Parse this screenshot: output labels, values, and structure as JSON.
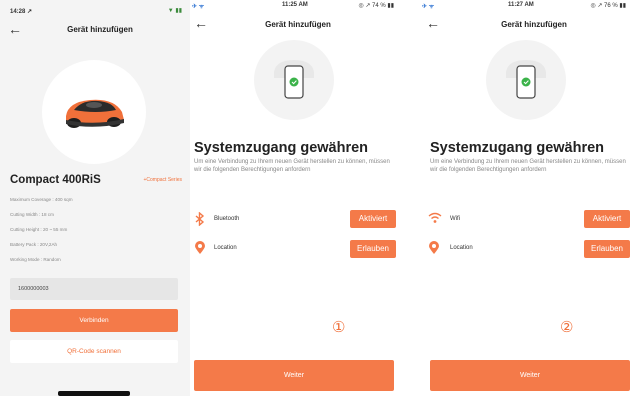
{
  "screen1": {
    "status": {
      "time": "14:28 ↗",
      "right": "▼ ▮▮"
    },
    "title": "Gerät hinzufügen",
    "product_name": "Compact 400RiS",
    "series_link": "+Compact Series",
    "specs": [
      "Maximum Coverage : 400 sqm",
      "Cutting Width : 18 cm",
      "Cutting Height : 20 ~ 55 mm",
      "Battery Pack : 20V,2Ah",
      "Working Mode : Random"
    ],
    "serial_value": "1600000003",
    "connect_button": "Verbinden",
    "qr_button": "QR-Code scannen"
  },
  "screen2": {
    "status": {
      "time": "11:25 AM",
      "left": "✈ ᯤ",
      "right": "◎ ↗ 74 % ▮▮"
    },
    "title": "Gerät hinzufügen",
    "heading": "Systemzugang gewähren",
    "description": "Um eine Verbindung zu Ihrem neuen Gerät herstellen zu können, müssen wir die folgenden Berechtigungen anfordern",
    "permissions": [
      {
        "icon": "bluetooth-icon",
        "label": "Bluetooth",
        "button": "Aktiviert"
      },
      {
        "icon": "location-icon",
        "label": "Location",
        "button": "Erlauben"
      }
    ],
    "step": "①",
    "next_button": "Weiter"
  },
  "screen3": {
    "status": {
      "time": "11:27 AM",
      "left": "✈ ᯤ",
      "right": "◎ ↗ 76 % ▮▮"
    },
    "title": "Gerät hinzufügen",
    "heading": "Systemzugang gewähren",
    "description": "Um eine Verbindung zu Ihrem neuen Gerät herstellen zu können, müssen wir die folgenden Berechtigungen anfordern",
    "permissions": [
      {
        "icon": "wifi-icon",
        "label": "Wifi",
        "button": "Aktiviert"
      },
      {
        "icon": "location-icon",
        "label": "Location",
        "button": "Erlauben"
      }
    ],
    "step": "②",
    "next_button": "Weiter"
  },
  "colors": {
    "accent": "#f47a49",
    "accent_text": "#f0703a"
  }
}
